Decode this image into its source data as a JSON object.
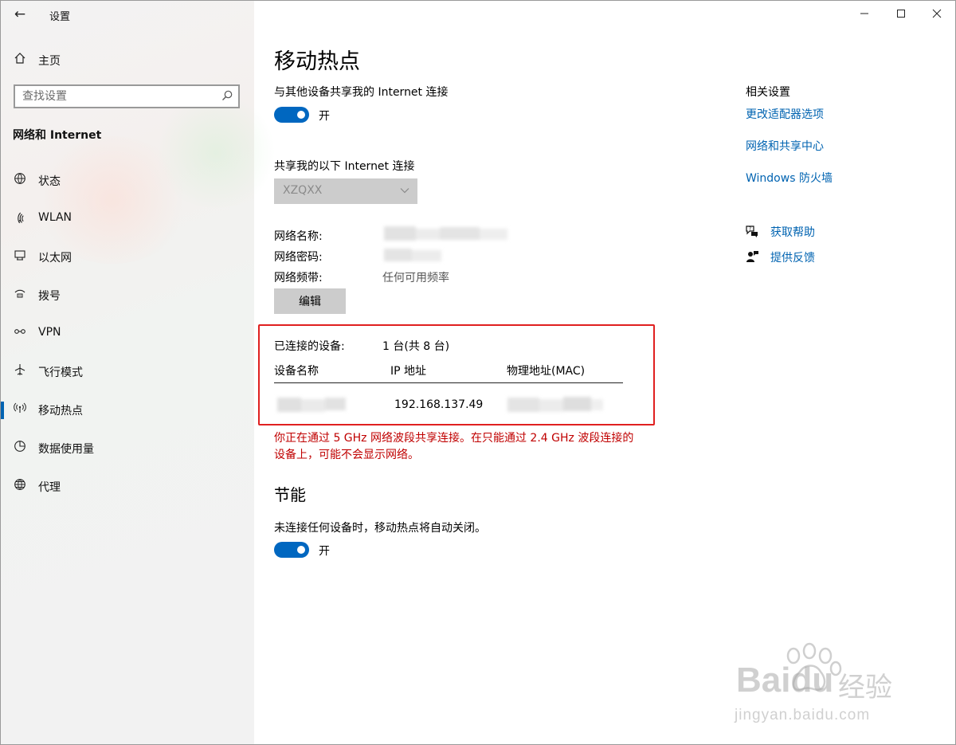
{
  "window": {
    "title": "设置",
    "back_icon": "back-arrow-icon",
    "controls": [
      "minimize",
      "maximize",
      "close"
    ]
  },
  "sidebar": {
    "home_label": "主页",
    "search_placeholder": "查找设置",
    "section_title": "网络和 Internet",
    "items": [
      {
        "label": "状态",
        "icon": "globe-status-icon",
        "active": false
      },
      {
        "label": "WLAN",
        "icon": "wifi-icon",
        "active": false
      },
      {
        "label": "以太网",
        "icon": "ethernet-icon",
        "active": false
      },
      {
        "label": "拨号",
        "icon": "dialup-icon",
        "active": false
      },
      {
        "label": "VPN",
        "icon": "vpn-icon",
        "active": false
      },
      {
        "label": "飞行模式",
        "icon": "airplane-icon",
        "active": false
      },
      {
        "label": "移动热点",
        "icon": "hotspot-icon",
        "active": true
      },
      {
        "label": "数据使用量",
        "icon": "data-usage-icon",
        "active": false
      },
      {
        "label": "代理",
        "icon": "globe-icon",
        "active": false
      }
    ]
  },
  "main": {
    "title": "移动热点",
    "share_label": "与其他设备共享我的 Internet 连接",
    "share_toggle": {
      "state": "开",
      "on": true
    },
    "share_from_label": "共享我的以下 Internet 连接",
    "share_from_value": "XZQXX",
    "network_name_label": "网络名称:",
    "network_password_label": "网络密码:",
    "network_band_label": "网络频带:",
    "network_band_value": "任何可用频率",
    "edit_button": "编辑",
    "connected_label": "已连接的设备:",
    "connected_value": "1 台(共 8 台)",
    "table_headers": [
      "设备名称",
      "IP 地址",
      "物理地址(MAC)"
    ],
    "table_rows": [
      {
        "ip": "192.168.137.49"
      }
    ],
    "warning": "你正在通过 5 GHz 网络波段共享连接。在只能通过 2.4 GHz 波段连接的设备上，可能不会显示网络。",
    "power_heading": "节能",
    "power_desc": "未连接任何设备时，移动热点将自动关闭。",
    "power_toggle": {
      "state": "开",
      "on": true
    }
  },
  "related": {
    "heading": "相关设置",
    "links": [
      "更改适配器选项",
      "网络和共享中心",
      "Windows 防火墙"
    ],
    "help_label": "获取帮助",
    "feedback_label": "提供反馈"
  },
  "watermark": {
    "brand": "Baidu",
    "brand_cn": "经验",
    "url": "jingyan.baidu.com"
  },
  "colors": {
    "accent": "#0067c0",
    "link": "#0063b1",
    "warning": "#c00000",
    "highlight_box": "#e02020",
    "sidebar_bg": "#f2f2f2"
  }
}
